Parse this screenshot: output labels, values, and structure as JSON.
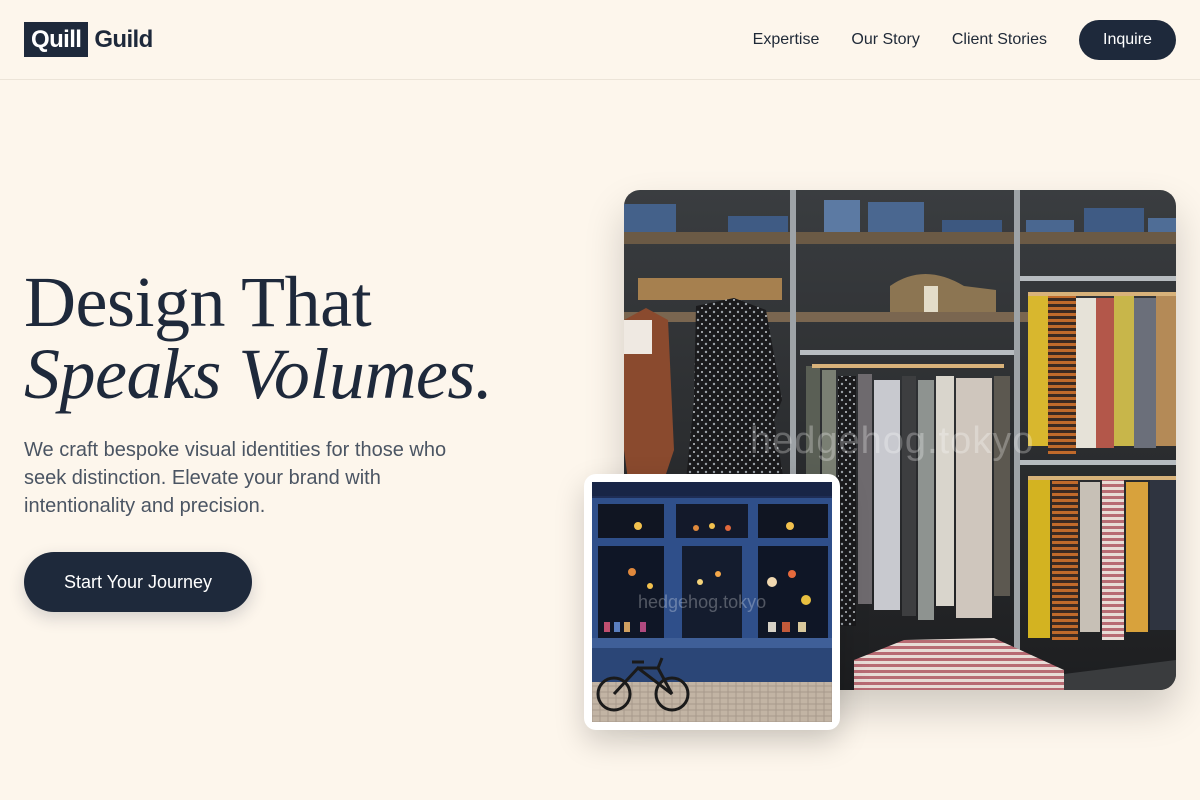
{
  "header": {
    "logo_box": "Quill",
    "logo_word": "Guild",
    "nav": [
      "Expertise",
      "Our Story",
      "Client Stories"
    ],
    "cta": "Inquire"
  },
  "hero": {
    "title_line1": "Design That",
    "title_line2": "Speaks Volumes.",
    "subtitle": "We craft bespoke visual identities for those who seek distinction. Elevate your brand with intentionality and precision.",
    "cta": "Start Your Journey"
  },
  "images": {
    "main": {
      "subject": "clothing-rack-boutique-photo",
      "watermark": "hedgehog.tokyo"
    },
    "inset": {
      "subject": "storefront-with-bicycle-photo",
      "watermark": "hedgehog.tokyo"
    }
  },
  "colors": {
    "background": "#fdf6ec",
    "primary": "#1e293b",
    "text_muted": "#4b5563"
  }
}
